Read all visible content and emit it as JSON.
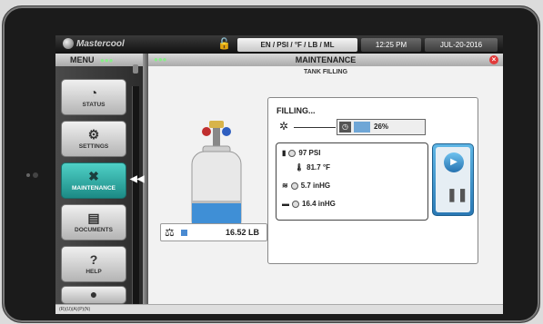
{
  "topbar": {
    "logo": "Mastercool",
    "units": "EN / PSI / °F / LB / ML",
    "time": "12:25 PM",
    "date": "JUL-20-2016"
  },
  "sidebar": {
    "title": "MENU",
    "items": [
      {
        "label": "STATUS",
        "icon": "gauge-icon"
      },
      {
        "label": "SETTINGS",
        "icon": "gear-icon"
      },
      {
        "label": "MAINTENANCE",
        "icon": "tools-icon"
      },
      {
        "label": "DOCUMENTS",
        "icon": "document-icon"
      },
      {
        "label": "HELP",
        "icon": "help-icon"
      }
    ]
  },
  "main": {
    "title": "MAINTENANCE",
    "subtitle": "TANK FILLING",
    "weight": "16.52 LB",
    "status": "FILLING...",
    "progress": "26%",
    "progress_value": 0.26,
    "readings": [
      {
        "value": "97 PSI",
        "icon": "tank-icon"
      },
      {
        "value": "81.7 °F",
        "icon": "thermometer-icon"
      },
      {
        "value": "5.7 inHG",
        "icon": "vacuum-icon"
      },
      {
        "value": "16.4 inHG",
        "icon": "car-icon"
      }
    ]
  },
  "bottombar": {
    "text": "(R)(U)(A)(P)(N)"
  },
  "colors": {
    "accent": "#2a9d96",
    "control": "#2a79b5",
    "close": "#e23b3b"
  }
}
